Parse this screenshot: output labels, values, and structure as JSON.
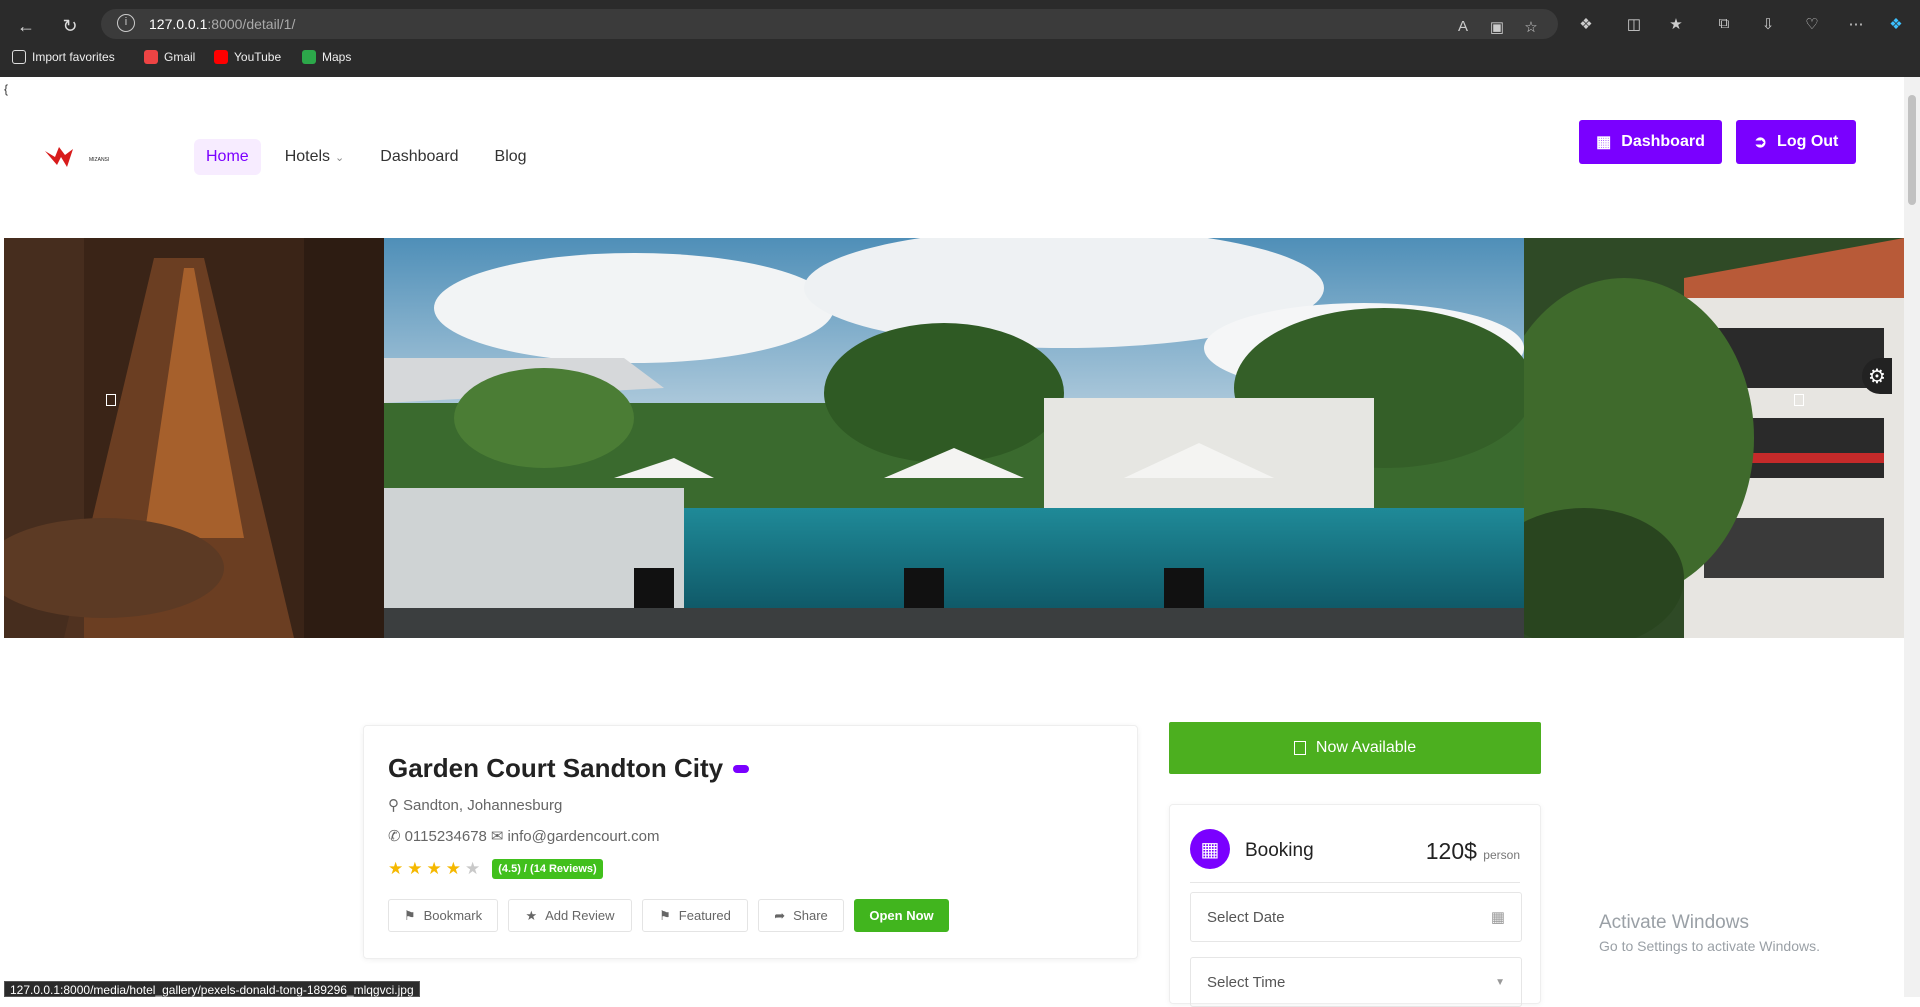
{
  "browser": {
    "url_host": "127.0.0.1",
    "url_rest": ":8000/detail/1/",
    "bookmarks": [
      "Import favorites",
      "Gmail",
      "YouTube",
      "Maps"
    ]
  },
  "page": {
    "brace": "{",
    "logo_text": "MIZANSI",
    "nav": {
      "home": "Home",
      "hotels": "Hotels",
      "dashboard": "Dashboard",
      "blog": "Blog"
    },
    "buttons": {
      "dashboard": "Dashboard",
      "logout": "Log Out"
    }
  },
  "hotel": {
    "name": "Garden Court Sandton City",
    "location": "Sandton, Johannesburg",
    "phone": "0115234678",
    "email": "info@gardencourt.com",
    "rating": 4.5,
    "rating_text": "(4.5) / (14 Reviews)",
    "actions": {
      "bookmark": "Bookmark",
      "review": "Add Review",
      "featured": "Featured",
      "share": "Share",
      "open": "Open Now"
    }
  },
  "sidebar": {
    "availability": "Now Available",
    "booking_title": "Booking",
    "price": "120$",
    "price_unit": "person",
    "date_placeholder": "Select Date",
    "time_placeholder": "Select Time"
  },
  "overlay": {
    "activate_title": "Activate Windows",
    "activate_sub": "Go to Settings to activate Windows."
  },
  "status_url": "127.0.0.1:8000/media/hotel_gallery/pexels-donald-tong-189296_mlqgvci.jpg"
}
